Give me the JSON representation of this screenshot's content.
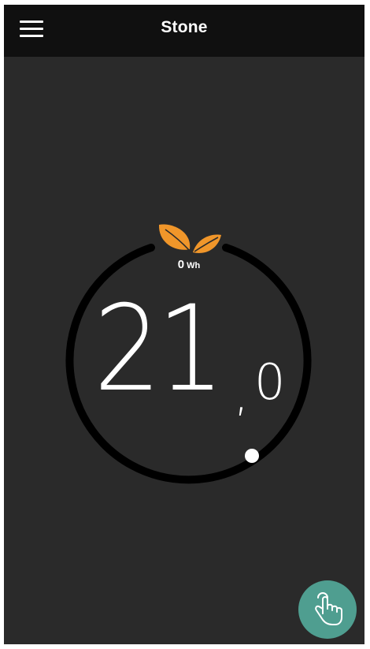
{
  "app": {
    "title": "Stone",
    "menu_icon": "hamburger-menu-icon"
  },
  "thermostat": {
    "eco_icon": "leaf-icon",
    "eco_color": "#f0962a",
    "energy_value": "0",
    "energy_unit": "Wh",
    "temperature_integer": "21",
    "temperature_separator": ",",
    "temperature_decimal": "0",
    "ring_color": "#000000",
    "knob_color": "#ffffff"
  },
  "actions": {
    "manual_override_icon": "hand-tap-icon",
    "fab_color": "#4f9e90"
  }
}
